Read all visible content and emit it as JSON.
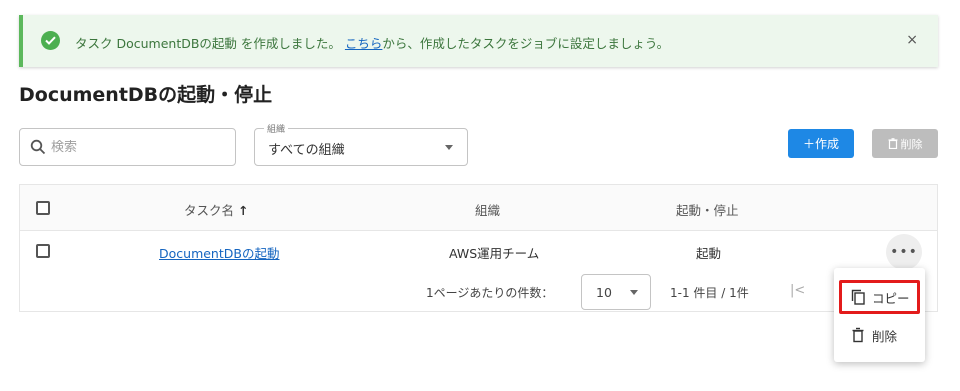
{
  "banner": {
    "text_before": "タスク DocumentDBの起動 を作成しました。",
    "link": "こちら",
    "text_after": "から、作成したタスクをジョブに設定しましょう。",
    "close": "×"
  },
  "page": {
    "title": "DocumentDBの起動・停止"
  },
  "filters": {
    "search_placeholder": "検索",
    "org_legend": "組織",
    "org_value": "すべての組織"
  },
  "actions": {
    "create": "＋作成",
    "delete": "削除"
  },
  "table": {
    "headers": {
      "task_name": "タスク名",
      "sort_arrow": "↑",
      "org": "組織",
      "startstop": "起動・停止"
    },
    "rows": [
      {
        "task_name": "DocumentDBの起動",
        "org": "AWS運用チーム",
        "action": "起動",
        "more": "•••"
      }
    ]
  },
  "pagination": {
    "per_page_label": "1ページあたりの件数：",
    "per_page_value": "10",
    "range": "1-1 件目 / 1件",
    "first": "|<"
  },
  "context_menu": {
    "copy": "コピー",
    "delete": "削除"
  },
  "colors": {
    "accent": "#1e88e5",
    "success": "#4caf50",
    "highlight": "#e31b1b"
  }
}
